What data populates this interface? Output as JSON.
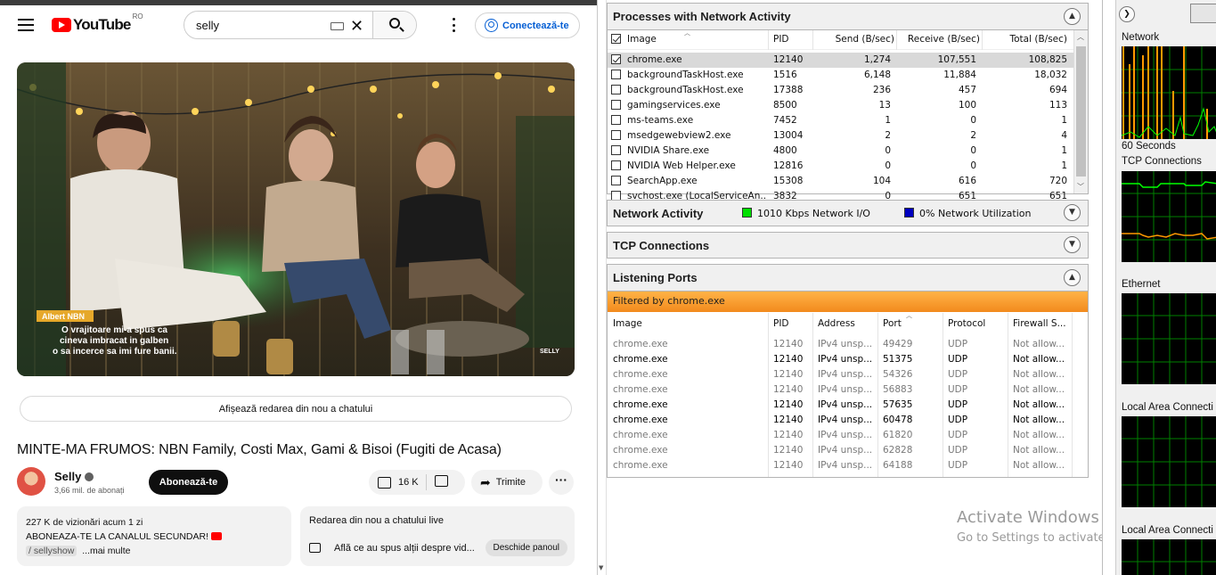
{
  "youtube": {
    "logo_text": "YouTube",
    "country_code": "RO",
    "search_value": "selly",
    "sign_in_label": "Conectează-te",
    "player": {
      "caption_name": "Albert NBN",
      "caption_lines": [
        "O vrajitoare mi-a spus ca",
        "cineva imbracat in galben",
        "o sa incerce sa imi fure banii."
      ],
      "watermark": "SELLY"
    },
    "replay_chat_label": "Afișează redarea din nou a chatului",
    "video_title": "MINTE-MA FRUMOS: NBN Family, Costi Max, Gami & Bisoi (Fugiti de Acasa)",
    "channel": {
      "name": "Selly",
      "subscribers": "3,66 mil. de abonați",
      "subscribe_label": "Abonează-te"
    },
    "actions": {
      "likes": "16 K",
      "share_label": "Trimite",
      "more_label": "···"
    },
    "description": {
      "stats": "227 K de vizionări  acum 1 zi",
      "line2": "ABONEAZA-TE LA CANALUL SECUNDAR!",
      "link": "/ sellyshow",
      "more": "...mai multe"
    },
    "live_chat": {
      "title": "Redarea din nou a chatului live",
      "prompt": "Află ce au spus alții despre vid...",
      "hide_label": "Deschide panoul"
    }
  },
  "resmon": {
    "processes": {
      "title": "Processes with Network Activity",
      "columns": [
        "Image",
        "PID",
        "Send (B/sec)",
        "Receive (B/sec)",
        "Total (B/sec)"
      ],
      "rows": [
        {
          "checked": true,
          "image": "chrome.exe",
          "pid": "12140",
          "send": "1,274",
          "recv": "107,551",
          "total": "108,825"
        },
        {
          "checked": false,
          "image": "backgroundTaskHost.exe",
          "pid": "1516",
          "send": "6,148",
          "recv": "11,884",
          "total": "18,032"
        },
        {
          "checked": false,
          "image": "backgroundTaskHost.exe",
          "pid": "17388",
          "send": "236",
          "recv": "457",
          "total": "694"
        },
        {
          "checked": false,
          "image": "gamingservices.exe",
          "pid": "8500",
          "send": "13",
          "recv": "100",
          "total": "113"
        },
        {
          "checked": false,
          "image": "ms-teams.exe",
          "pid": "7452",
          "send": "1",
          "recv": "0",
          "total": "1"
        },
        {
          "checked": false,
          "image": "msedgewebview2.exe",
          "pid": "13004",
          "send": "2",
          "recv": "2",
          "total": "4"
        },
        {
          "checked": false,
          "image": "NVIDIA Share.exe",
          "pid": "4800",
          "send": "0",
          "recv": "0",
          "total": "1"
        },
        {
          "checked": false,
          "image": "NVIDIA Web Helper.exe",
          "pid": "12816",
          "send": "0",
          "recv": "0",
          "total": "1"
        },
        {
          "checked": false,
          "image": "SearchApp.exe",
          "pid": "15308",
          "send": "104",
          "recv": "616",
          "total": "720"
        },
        {
          "checked": false,
          "image": "svchost.exe (LocalServiceAn...",
          "pid": "3832",
          "send": "0",
          "recv": "651",
          "total": "651"
        }
      ]
    },
    "network_activity": {
      "title": "Network Activity",
      "io_label": "1010 Kbps Network I/O",
      "util_label": "0% Network Utilization",
      "io_color": "#00e000",
      "util_color": "#0000c0"
    },
    "tcp": {
      "title": "TCP Connections"
    },
    "listening": {
      "title": "Listening Ports",
      "filter": "Filtered by chrome.exe",
      "columns": [
        "Image",
        "PID",
        "Address",
        "Port",
        "Protocol",
        "Firewall S..."
      ],
      "rows": [
        {
          "bold": false,
          "image": "chrome.exe",
          "pid": "12140",
          "addr": "IPv4 unsp...",
          "port": "49429",
          "proto": "UDP",
          "fw": "Not allow..."
        },
        {
          "bold": true,
          "image": "chrome.exe",
          "pid": "12140",
          "addr": "IPv4 unsp...",
          "port": "51375",
          "proto": "UDP",
          "fw": "Not allow..."
        },
        {
          "bold": false,
          "image": "chrome.exe",
          "pid": "12140",
          "addr": "IPv4 unsp...",
          "port": "54326",
          "proto": "UDP",
          "fw": "Not allow..."
        },
        {
          "bold": false,
          "image": "chrome.exe",
          "pid": "12140",
          "addr": "IPv4 unsp...",
          "port": "56883",
          "proto": "UDP",
          "fw": "Not allow..."
        },
        {
          "bold": true,
          "image": "chrome.exe",
          "pid": "12140",
          "addr": "IPv4 unsp...",
          "port": "57635",
          "proto": "UDP",
          "fw": "Not allow..."
        },
        {
          "bold": true,
          "image": "chrome.exe",
          "pid": "12140",
          "addr": "IPv4 unsp...",
          "port": "60478",
          "proto": "UDP",
          "fw": "Not allow..."
        },
        {
          "bold": false,
          "image": "chrome.exe",
          "pid": "12140",
          "addr": "IPv4 unsp...",
          "port": "61820",
          "proto": "UDP",
          "fw": "Not allow..."
        },
        {
          "bold": false,
          "image": "chrome.exe",
          "pid": "12140",
          "addr": "IPv4 unsp...",
          "port": "62828",
          "proto": "UDP",
          "fw": "Not allow..."
        },
        {
          "bold": false,
          "image": "chrome.exe",
          "pid": "12140",
          "addr": "IPv4 unsp...",
          "port": "64188",
          "proto": "UDP",
          "fw": "Not allow..."
        }
      ]
    },
    "graphs": {
      "network": "Network",
      "seconds": "60 Seconds",
      "tcp": "TCP Connections",
      "ethernet": "Ethernet",
      "lan1": "Local Area Connecti",
      "lan2": "Local Area Connecti"
    },
    "watermark": {
      "line1": "Activate Windows",
      "line2": "Go to Settings to activate Windows."
    }
  }
}
